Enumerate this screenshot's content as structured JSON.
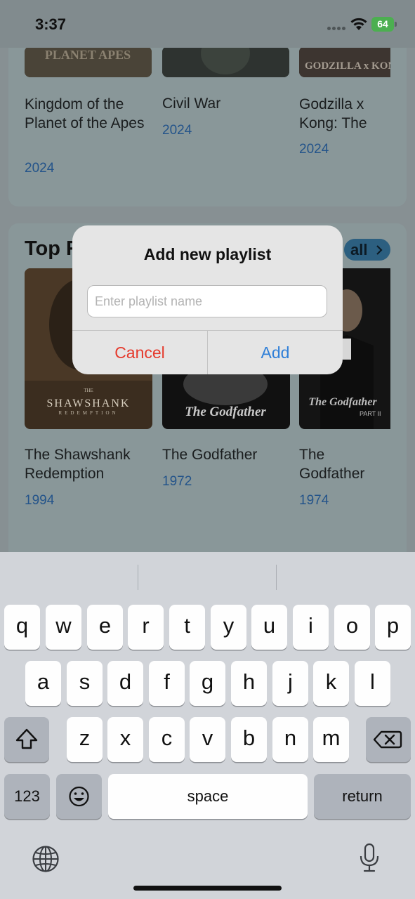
{
  "status_bar": {
    "time": "3:37",
    "battery": "64"
  },
  "row1_movies": [
    {
      "title": "Kingdom of the Planet of the Apes",
      "year": "2024",
      "poster_text": "PLANET APES"
    },
    {
      "title": "Civil War",
      "year": "2024",
      "poster_text": ""
    },
    {
      "title": "Godzilla x Kong: The New Empire",
      "year": "2024",
      "poster_text": "GODZILLA x KONG THE NEW EMPIRE"
    }
  ],
  "section2": {
    "title": "Top Rated",
    "see_all": "all"
  },
  "row2_movies": [
    {
      "title": "The Shawshank Redemption",
      "year": "1994",
      "poster_text": "SHAWSHANK",
      "poster_sub": "REDEMPTION",
      "poster_prefix": "THE"
    },
    {
      "title": "The Godfather",
      "year": "1972",
      "poster_text": "The Godfather"
    },
    {
      "title": "The Godfather Part II",
      "year": "1974",
      "poster_text": "The Godfather",
      "poster_sub": "PART II"
    }
  ],
  "dialog": {
    "title": "Add new playlist",
    "input_placeholder": "Enter playlist name",
    "input_value": "",
    "cancel_label": "Cancel",
    "add_label": "Add"
  },
  "keyboard": {
    "row1": [
      "q",
      "w",
      "e",
      "r",
      "t",
      "y",
      "u",
      "i",
      "o",
      "p"
    ],
    "row2": [
      "a",
      "s",
      "d",
      "f",
      "g",
      "h",
      "j",
      "k",
      "l"
    ],
    "row3": [
      "z",
      "x",
      "c",
      "v",
      "b",
      "n",
      "m"
    ],
    "numbers_label": "123",
    "space_label": "space",
    "return_label": "return"
  },
  "colors": {
    "cancel": "#e5392c",
    "add": "#2f7fd8",
    "year": "#24548a"
  }
}
